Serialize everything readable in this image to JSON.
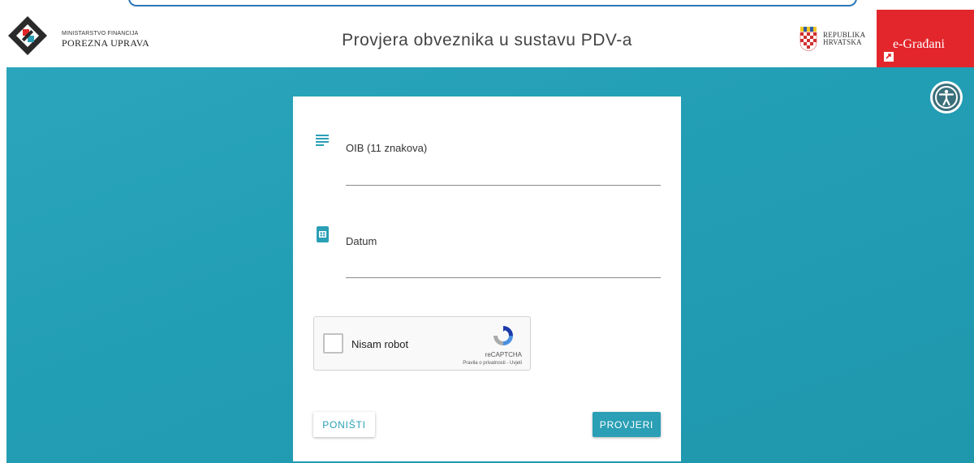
{
  "header": {
    "ministry": "MINISTARSTVO FINANCIJA",
    "agency": "POREZNA UPRAVA",
    "title": "Provjera obveznika u sustavu PDV-a",
    "republic_line1": "REPUBLIKA",
    "republic_line2": "HRVATSKA",
    "egradani_label": "e-Građani"
  },
  "form": {
    "oib_label": "OIB (11 znakova)",
    "oib_value": "",
    "date_label": "Datum",
    "date_value": "",
    "captcha": {
      "label": "Nisam robot",
      "brand": "reCAPTCHA",
      "links": "Pravila o privatnosti - Uvjeti",
      "checked": false
    },
    "reset_label": "PONIŠTI",
    "submit_label": "PROVJERI"
  },
  "icons": {
    "logo": "porezna-uprava-logo",
    "oib_field": "text-lines-icon",
    "date_field": "calendar-icon",
    "accessibility": "accessibility-icon",
    "egradani_link": "external-link-icon",
    "republic": "croatian-coat-of-arms"
  },
  "colors": {
    "background": "#229eb4",
    "accent": "#2a9fb5",
    "egradani": "#e2262b"
  }
}
